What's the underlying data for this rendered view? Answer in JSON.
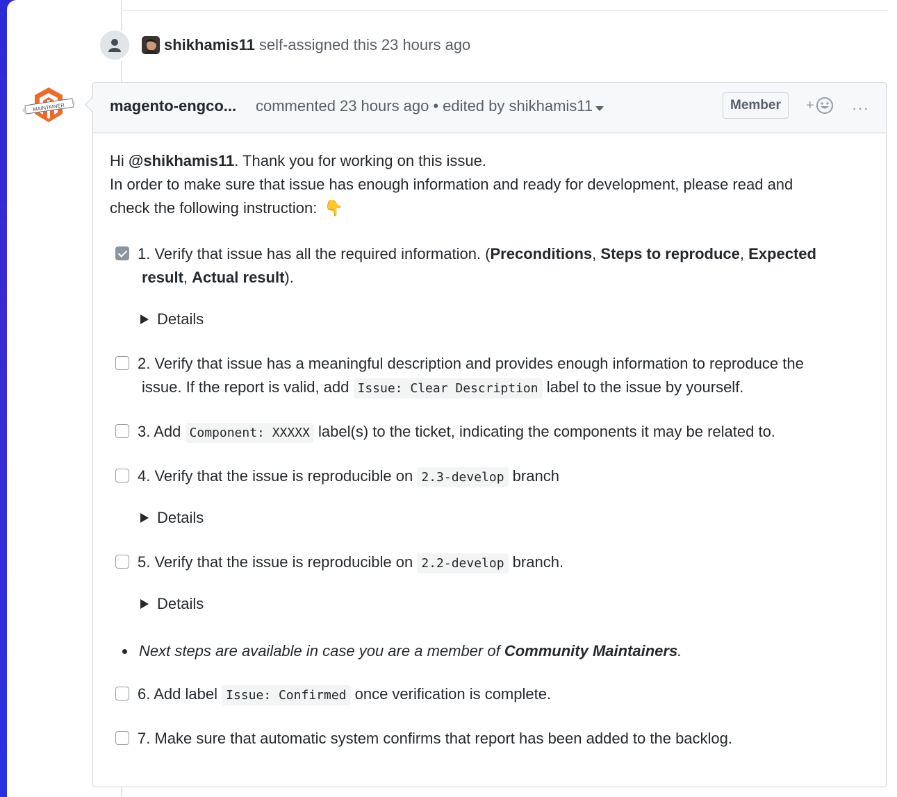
{
  "event": {
    "actor": "shikhamis11",
    "action": "self-assigned this",
    "time": "23 hours ago"
  },
  "comment": {
    "author": "magento-engco...",
    "commented": "commented",
    "time": "23 hours ago",
    "separator": "•",
    "edited": "edited by shikhamis11",
    "member_badge": "Member",
    "reaction_plus": "+",
    "more": "···",
    "avatar_label": "MAINTAINER"
  },
  "body": {
    "greeting_pre": "Hi ",
    "mention": "@shikhamis11",
    "greeting_post": ". Thank you for working on this issue.",
    "intro_line1": "In order to make sure that issue has enough information and ready for development, please read and",
    "intro_line2": "check the following instruction:",
    "emoji": "👇"
  },
  "tasks": [
    {
      "checked": true,
      "line1_a": "1. Verify that issue has all the required information. (",
      "b1": "Preconditions",
      "sep1": ", ",
      "b2": "Steps to reproduce",
      "sep2": ", ",
      "b3": "Expected",
      "b4": "result",
      "sep3": ", ",
      "b5": "Actual result",
      "end": ")."
    },
    {
      "checked": false,
      "line1": "2. Verify that issue has a meaningful description and provides enough information to reproduce the",
      "line2_a": "issue. If the report is valid, add ",
      "code": "Issue: Clear Description",
      "line2_b": " label to the issue by yourself."
    },
    {
      "checked": false,
      "pre": "3. Add ",
      "code": "Component: XXXXX",
      "post": " label(s) to the ticket, indicating the components it may be related to."
    },
    {
      "checked": false,
      "pre": "4. Verify that the issue is reproducible on ",
      "code": "2.3-develop",
      "post": " branch"
    },
    {
      "checked": false,
      "pre": "5. Verify that the issue is reproducible on ",
      "code": "2.2-develop",
      "post": " branch."
    },
    {
      "checked": false,
      "pre": "6. Add label ",
      "code": "Issue: Confirmed",
      "post": " once verification is complete."
    },
    {
      "checked": false,
      "text": "7. Make sure that automatic system confirms that report has been added to the backlog."
    }
  ],
  "details_label": "Details",
  "bullet": {
    "pre": "Next steps are available in case you are a member of ",
    "bold": "Community Maintainers",
    "post": "."
  }
}
